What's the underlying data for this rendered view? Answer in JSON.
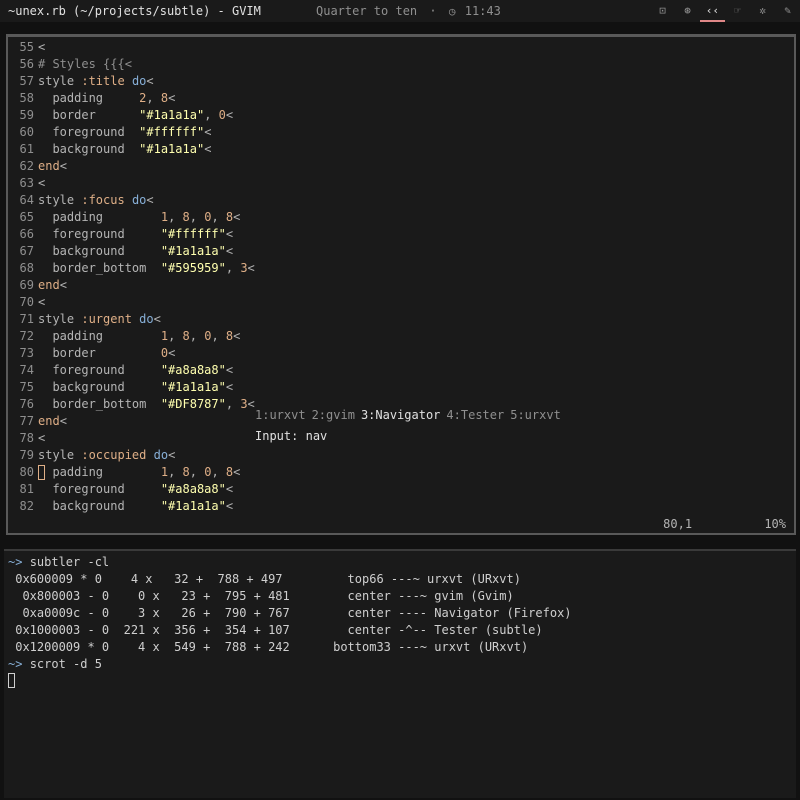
{
  "panel": {
    "title": "~unex.rb (~/projects/subtle) - GVIM",
    "clock_text": "Quarter to ten",
    "separator": "·",
    "time": "11:43",
    "views": [
      {
        "icon": "terminal-icon",
        "glyph": "⊡",
        "active": false
      },
      {
        "icon": "browser-icon",
        "glyph": "⊛",
        "active": false
      },
      {
        "icon": "quote-icon",
        "glyph": "‹‹",
        "active": true
      },
      {
        "icon": "hand-icon",
        "glyph": "☞",
        "active": false
      },
      {
        "icon": "bug-icon",
        "glyph": "✲",
        "active": false
      },
      {
        "icon": "pencil-icon",
        "glyph": "✎",
        "active": false
      }
    ]
  },
  "editor": {
    "lines": [
      {
        "n": "55",
        "t": "<"
      },
      {
        "n": "56",
        "t": "# Styles {{{<"
      },
      {
        "n": "57",
        "t": "style :title do<"
      },
      {
        "n": "58",
        "t": "  padding     2, 8<"
      },
      {
        "n": "59",
        "t": "  border      \"#1a1a1a\", 0<"
      },
      {
        "n": "60",
        "t": "  foreground  \"#ffffff\"<"
      },
      {
        "n": "61",
        "t": "  background  \"#1a1a1a\"<"
      },
      {
        "n": "62",
        "t": "end<"
      },
      {
        "n": "63",
        "t": "<"
      },
      {
        "n": "64",
        "t": "style :focus do<"
      },
      {
        "n": "65",
        "t": "  padding        1, 8, 0, 8<"
      },
      {
        "n": "66",
        "t": "  foreground     \"#ffffff\"<"
      },
      {
        "n": "67",
        "t": "  background     \"#1a1a1a\"<"
      },
      {
        "n": "68",
        "t": "  border_bottom  \"#595959\", 3<"
      },
      {
        "n": "69",
        "t": "end<"
      },
      {
        "n": "70",
        "t": "<"
      },
      {
        "n": "71",
        "t": "style :urgent do<"
      },
      {
        "n": "72",
        "t": "  padding        1, 8, 0, 8<"
      },
      {
        "n": "73",
        "t": "  border         0<"
      },
      {
        "n": "74",
        "t": "  foreground     \"#a8a8a8\"<"
      },
      {
        "n": "75",
        "t": "  background     \"#1a1a1a\"<"
      },
      {
        "n": "76",
        "t": "  border_bottom  \"#DF8787\", 3<"
      },
      {
        "n": "77",
        "t": "end<"
      },
      {
        "n": "78",
        "t": "<"
      },
      {
        "n": "79",
        "t": "style :occupied do<"
      },
      {
        "n": "80",
        "t": "  padding        1, 8, 0, 8<"
      },
      {
        "n": "81",
        "t": "  foreground     \"#a8a8a8\"<"
      },
      {
        "n": "82",
        "t": "  background     \"#1a1a1a\"<"
      }
    ],
    "position": "80,1",
    "percent": "10%"
  },
  "launcher": {
    "views": [
      {
        "label": "1:urxvt",
        "selected": false
      },
      {
        "label": "2:gvim",
        "selected": false
      },
      {
        "label": "3:Navigator",
        "selected": true
      },
      {
        "label": "4:Tester",
        "selected": false
      },
      {
        "label": "5:urxvt",
        "selected": false
      }
    ],
    "input_label": "Input:",
    "input_value": "nav"
  },
  "terminal": {
    "prompt": "~>",
    "command1": "subtler -cl",
    "rows": [
      " 0x600009 * 0    4 x   32 +  788 + 497         top66 ---~ urxvt (URxvt)",
      "  0x800003 - 0    0 x   23 +  795 + 481        center ---~ gvim (Gvim)",
      "  0xa0009c - 0    3 x   26 +  790 + 767        center ---- Navigator (Firefox)",
      " 0x1000003 - 0  221 x  356 +  354 + 107        center -^-- Tester (subtle)",
      " 0x1200009 * 0    4 x  549 +  788 + 242      bottom33 ---~ urxvt (URxvt)"
    ],
    "command2": "scrot -d 5"
  },
  "colors": {
    "accent": "#DF8787",
    "border": "#595959",
    "background": "#1a1a1a"
  }
}
